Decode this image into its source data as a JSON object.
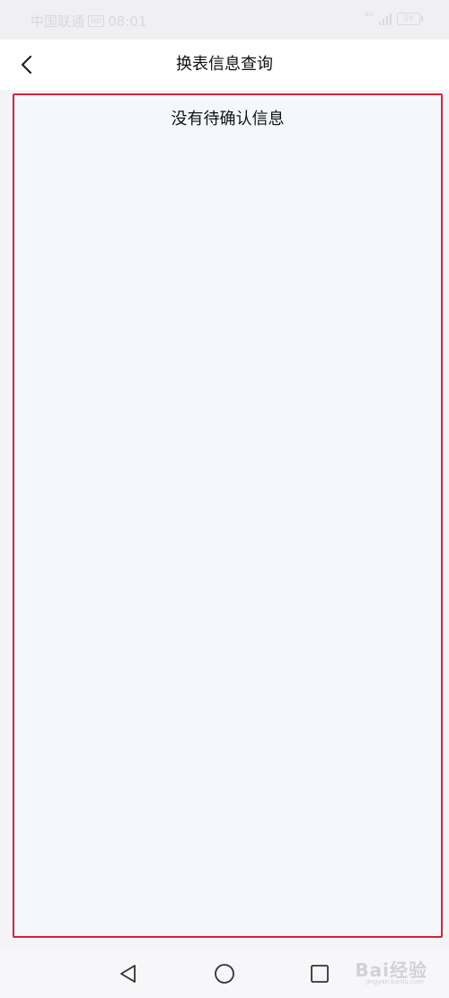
{
  "status_bar": {
    "carrier": "中国联通",
    "hd_badge": "HD",
    "time": "08:01",
    "network_type": "4G",
    "battery_level": "59"
  },
  "header": {
    "title": "换表信息查询",
    "back_icon": "chevron-left-icon"
  },
  "content": {
    "empty_message": "没有待确认信息",
    "highlight_color": "#d9223a",
    "background_color": "#f4f8fd"
  },
  "bottom_nav": {
    "back_icon": "triangle-back-icon",
    "home_icon": "circle-home-icon",
    "recent_icon": "square-recent-icon"
  },
  "watermark": {
    "text": "Bai经验",
    "sub": "jingyan.baidu.com"
  }
}
